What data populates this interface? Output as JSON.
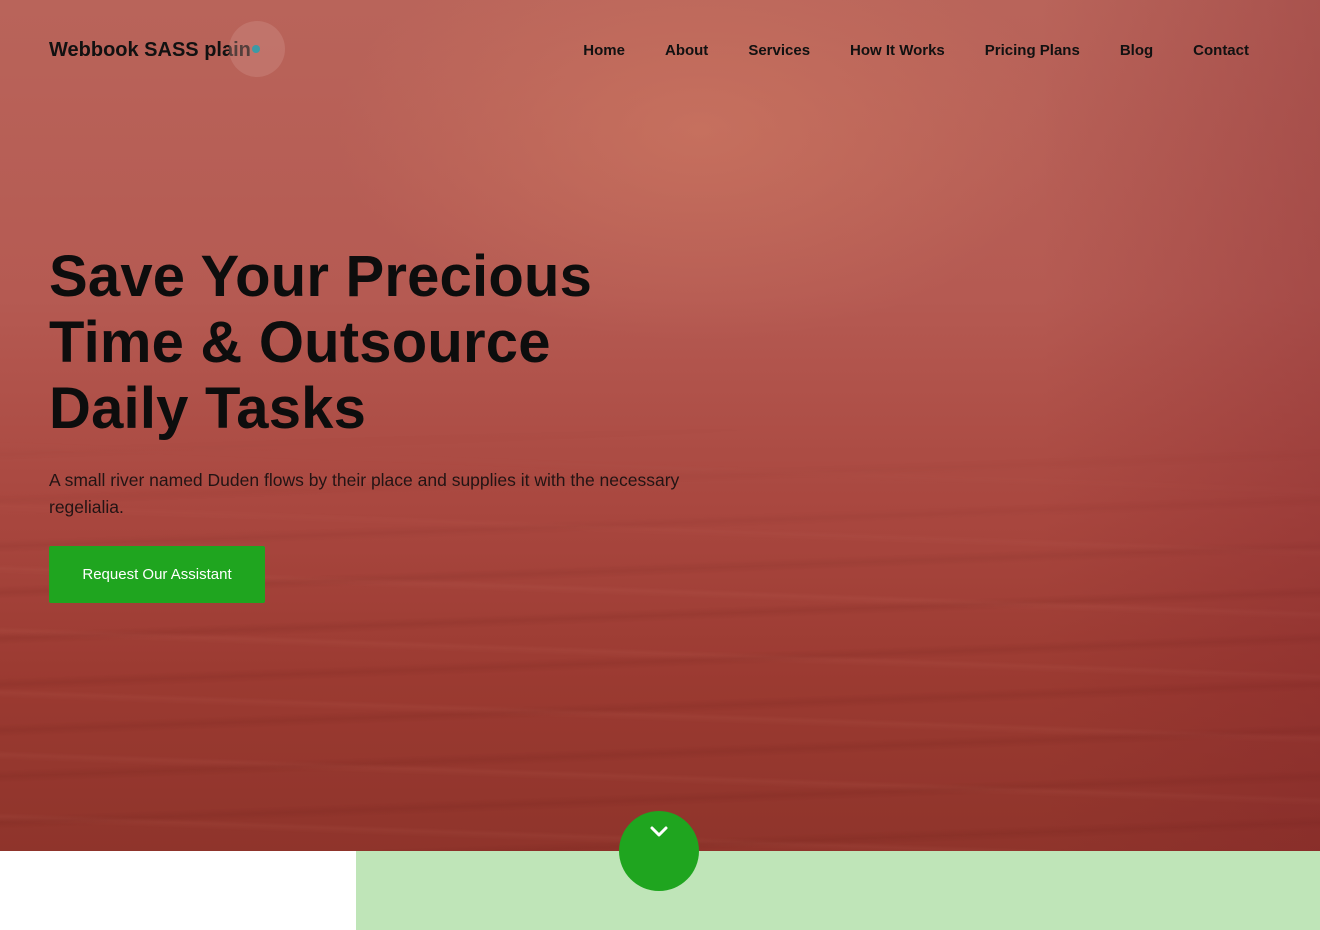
{
  "brand": {
    "name": "Webbook SASS plain"
  },
  "nav": {
    "items": [
      {
        "label": "Home"
      },
      {
        "label": "About"
      },
      {
        "label": "Services"
      },
      {
        "label": "How It Works"
      },
      {
        "label": "Pricing Plans"
      },
      {
        "label": "Blog"
      },
      {
        "label": "Contact"
      }
    ]
  },
  "hero": {
    "title_lines": [
      "Save Your Precious",
      "Time & Outsource",
      "Daily Tasks"
    ],
    "subtitle": "A small river named Duden flows by their place and supplies it with the necessary regelialia.",
    "cta_label": "Request Our Assistant"
  },
  "icons": {
    "scroll_down": "chevron-down-icon",
    "brand_dot": "dot-icon"
  },
  "colors": {
    "accent_green": "#1fa51f",
    "band_green": "#bfe5b8",
    "hero_overlay": "#b55a52"
  }
}
